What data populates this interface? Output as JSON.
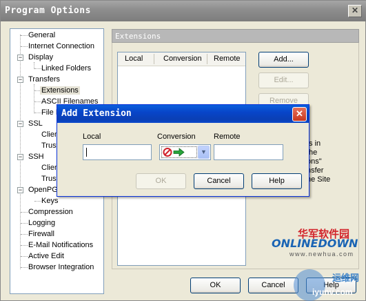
{
  "main": {
    "title": "Program Options",
    "close_glyph": "✕",
    "tree": [
      {
        "label": "General"
      },
      {
        "label": "Internet Connection"
      },
      {
        "label": "Display",
        "expander": "−"
      },
      {
        "label": "Linked Folders"
      },
      {
        "label": "Transfers",
        "expander": "−"
      },
      {
        "label": "Extensions"
      },
      {
        "label": "ASCII Filenames"
      },
      {
        "label": "File I"
      },
      {
        "label": "SSL",
        "expander": "−"
      },
      {
        "label": "Clien"
      },
      {
        "label": "Trust"
      },
      {
        "label": "SSH",
        "expander": "−"
      },
      {
        "label": "Clien"
      },
      {
        "label": "Trust"
      },
      {
        "label": "OpenPG",
        "expander": "−"
      },
      {
        "label": "Keys"
      },
      {
        "label": "Compression"
      },
      {
        "label": "Logging"
      },
      {
        "label": "Firewall"
      },
      {
        "label": "E-Mail Notifications"
      },
      {
        "label": "Active Edit"
      },
      {
        "label": "Browser Integration"
      }
    ],
    "section_header": "Extensions",
    "columns": [
      "Local",
      "Conversion",
      "Remote"
    ],
    "buttons": {
      "add": "Add...",
      "edit": "Edit...",
      "remove": "Remove",
      "ok": "OK",
      "cancel": "Cancel",
      "help": "Help"
    },
    "description_lines": [
      "ts in",
      "the",
      "ons\"",
      "nsfer",
      "he Site"
    ]
  },
  "dialog": {
    "title": "Add Extension",
    "close_glyph": "✕",
    "local_label": "Local",
    "conversion_label": "Conversion",
    "remote_label": "Remote",
    "local_value": "",
    "remote_value": "",
    "buttons": {
      "ok": "OK",
      "cancel": "Cancel",
      "help": "Help"
    }
  },
  "watermark": {
    "chinese_text": "华军软件园",
    "brand_text": "ONLINEDOWN",
    "url_text": "www.newhua.com",
    "site_text": "iyunv.com",
    "site_chinese": "运维网"
  },
  "colors": {
    "dialog_titlebar": "#0a45c9",
    "inactive_titlebar": "#8f8f8f",
    "window_face": "#ece9d8",
    "brand_red": "#d2232a",
    "brand_blue": "#1a64b4"
  }
}
